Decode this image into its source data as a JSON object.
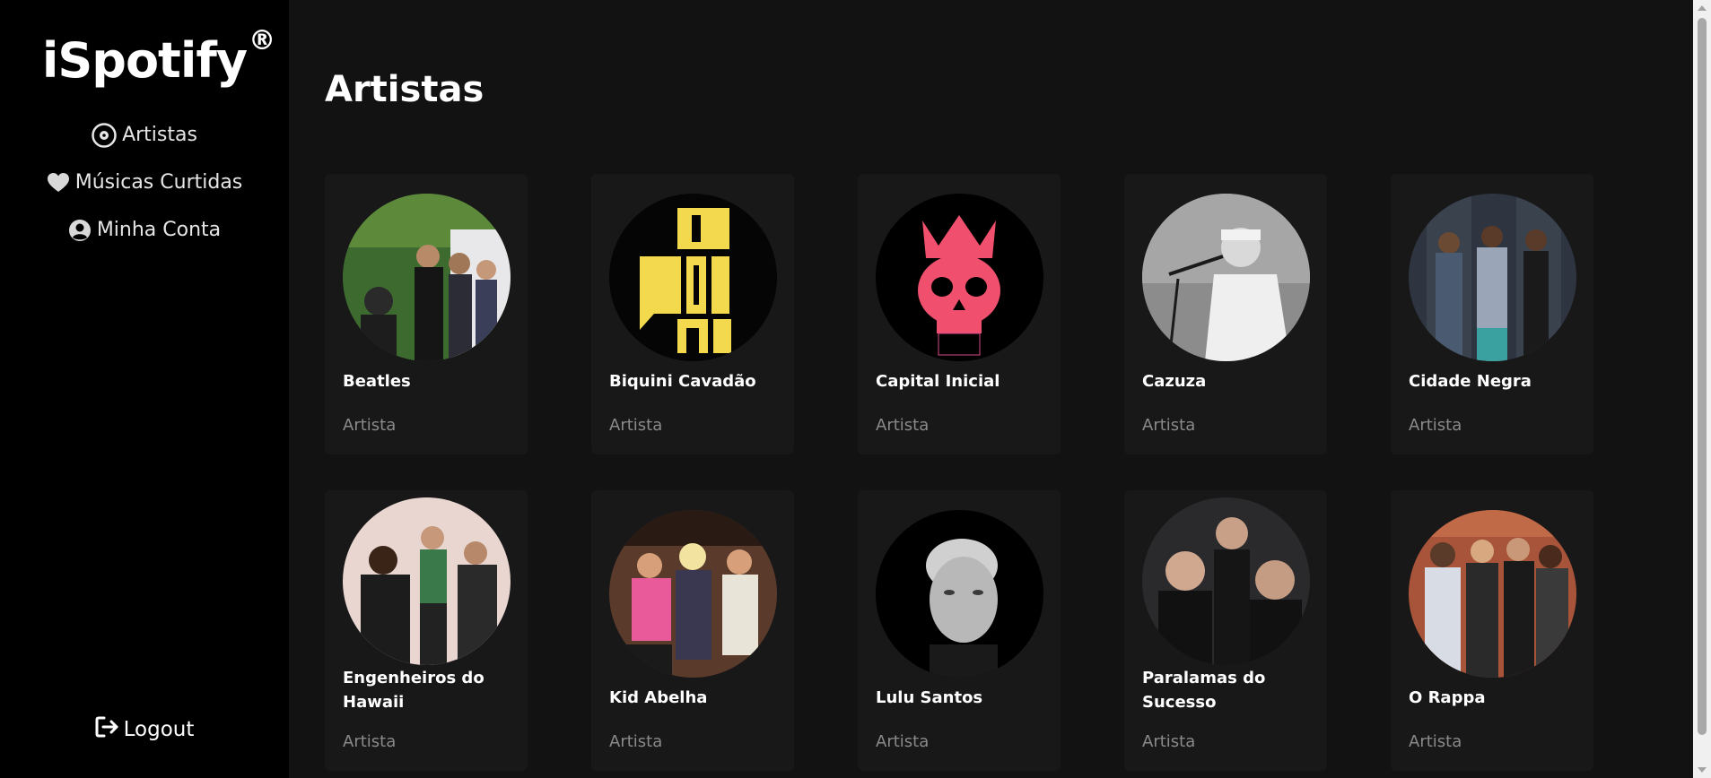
{
  "app": {
    "title": "iSpotify",
    "registered_mark": "®"
  },
  "sidebar": {
    "items": [
      {
        "label": "Artistas",
        "icon": "vinyl-disc-icon"
      },
      {
        "label": "Músicas Curtidas",
        "icon": "heart-icon"
      },
      {
        "label": "Minha Conta",
        "icon": "user-circle-icon"
      }
    ],
    "logout_label": "Logout",
    "logout_icon": "logout-arrow-icon"
  },
  "main": {
    "title": "Artistas",
    "artists": [
      {
        "name": "Beatles",
        "subtitle": "Artista"
      },
      {
        "name": "Biquini Cavadão",
        "subtitle": "Artista"
      },
      {
        "name": "Capital Inicial",
        "subtitle": "Artista"
      },
      {
        "name": "Cazuza",
        "subtitle": "Artista"
      },
      {
        "name": "Cidade Negra",
        "subtitle": "Artista"
      },
      {
        "name": "Engenheiros do Hawaii",
        "subtitle": "Artista"
      },
      {
        "name": "Kid Abelha",
        "subtitle": "Artista"
      },
      {
        "name": "Lulu Santos",
        "subtitle": "Artista"
      },
      {
        "name": "Paralamas do Sucesso",
        "subtitle": "Artista"
      },
      {
        "name": "O Rappa",
        "subtitle": "Artista"
      }
    ]
  },
  "colors": {
    "sidebar_bg": "#000000",
    "main_bg": "#121212",
    "card_bg": "#181818",
    "subtitle_text": "#8a8a8a",
    "biquini_yellow": "#f2d94e",
    "capital_pink": "#f0506e"
  }
}
